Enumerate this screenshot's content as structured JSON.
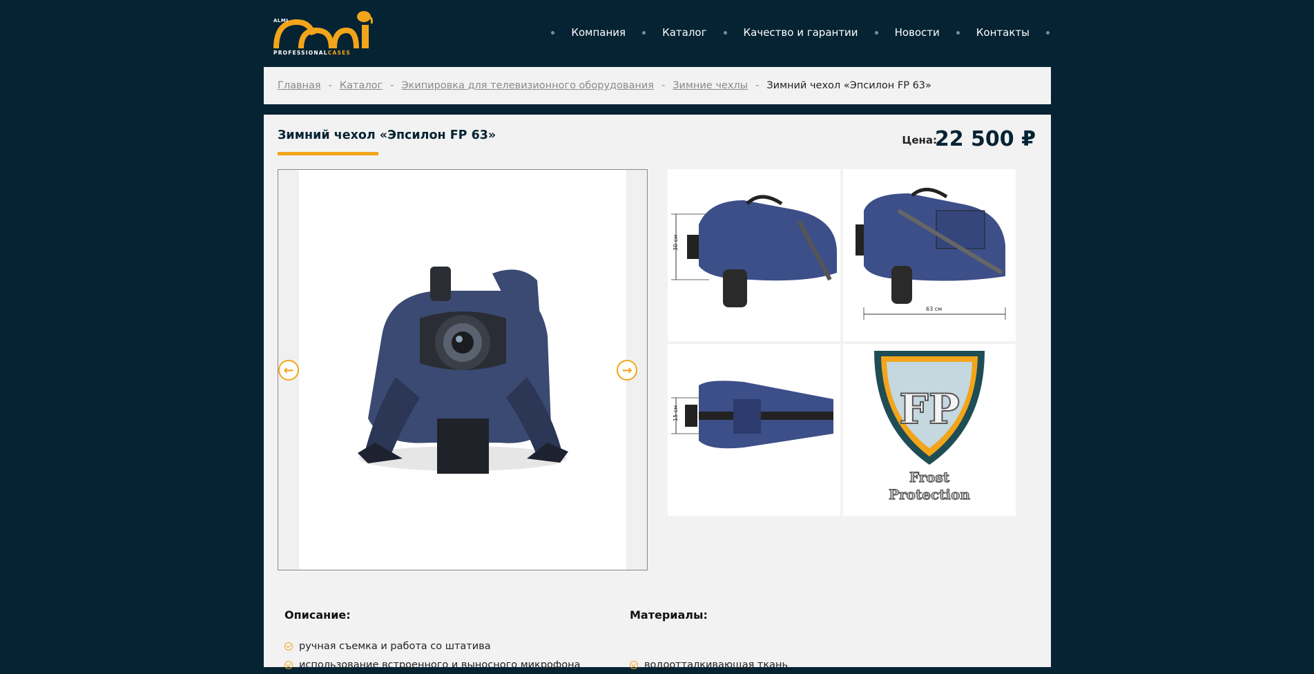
{
  "brand": {
    "small": "ALMI",
    "tagline_a": "PROFESSIONAL",
    "tagline_b": "CASES",
    "accent": "#f2a51a",
    "background": "#062333"
  },
  "nav": [
    {
      "label": "Компания"
    },
    {
      "label": "Каталог"
    },
    {
      "label": "Качество и гарантии"
    },
    {
      "label": "Новости"
    },
    {
      "label": "Контакты"
    }
  ],
  "breadcrumb": {
    "items": [
      "Главная",
      "Каталог",
      "Экипировка для телевизионного оборудования",
      "Зимние чехлы"
    ],
    "current": "Зимний чехол «Эпсилон FP 63»",
    "separator": "-"
  },
  "product": {
    "title": "Зимний чехол «Эпсилон FP 63»",
    "price_label": "Цена:",
    "price": "22 500 ₽"
  },
  "gallery": {
    "prev_icon": "arrow-left-icon",
    "next_icon": "arrow-right-icon",
    "thumbs": [
      {
        "dimension": "30 см"
      },
      {
        "dimension": "63 см"
      },
      {
        "dimension": "15 см"
      },
      {
        "logo_letters": "FP",
        "logo_line1": "Frost",
        "logo_line2": "Protection"
      }
    ]
  },
  "description": {
    "heading": "Описание:",
    "items": [
      "ручная съемка и работа со штатива",
      "использование встроенного и выносного микрофона"
    ]
  },
  "materials": {
    "heading": "Материалы:",
    "items": [
      "водоотталкивающая ткань"
    ]
  }
}
